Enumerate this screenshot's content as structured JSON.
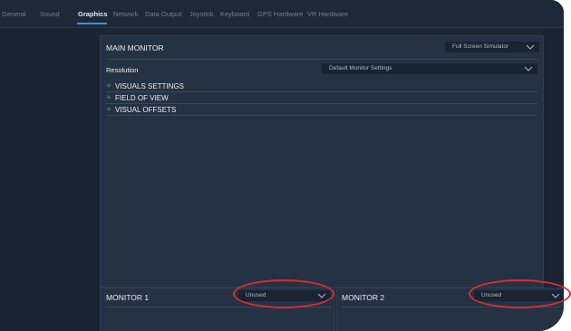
{
  "tabs": [
    {
      "label": "General",
      "active": false
    },
    {
      "label": "Sound",
      "active": false
    },
    {
      "label": "Graphics",
      "active": true
    },
    {
      "label": "Network",
      "active": false
    },
    {
      "label": "Data Output",
      "active": false
    },
    {
      "label": "Joystick",
      "active": false
    },
    {
      "label": "Keyboard",
      "active": false
    },
    {
      "label": "GPS Hardware",
      "active": false
    },
    {
      "label": "VR Hardware",
      "active": false
    }
  ],
  "main_monitor": {
    "title": "MAIN MONITOR",
    "mode_value": "Full Screen Simulator",
    "resolution_label": "Resolution",
    "resolution_value": "Default Monitor Settings"
  },
  "sections": [
    {
      "label": "VISUALS SETTINGS",
      "expand_icon": "plus-icon"
    },
    {
      "label": "FIELD OF VIEW",
      "expand_icon": "plus-icon"
    },
    {
      "label": "VISUAL OFFSETS",
      "expand_icon": "plus-icon"
    }
  ],
  "monitor1": {
    "title": "MONITOR 1",
    "value": "Unused"
  },
  "monitor2": {
    "title": "MONITOR 2",
    "value": "Unused"
  },
  "colors": {
    "background": "#1c2634",
    "panel": "#253244",
    "select_bg": "#1a2332",
    "accent": "#3d8fd6",
    "highlight_oval": "#d22d35"
  }
}
